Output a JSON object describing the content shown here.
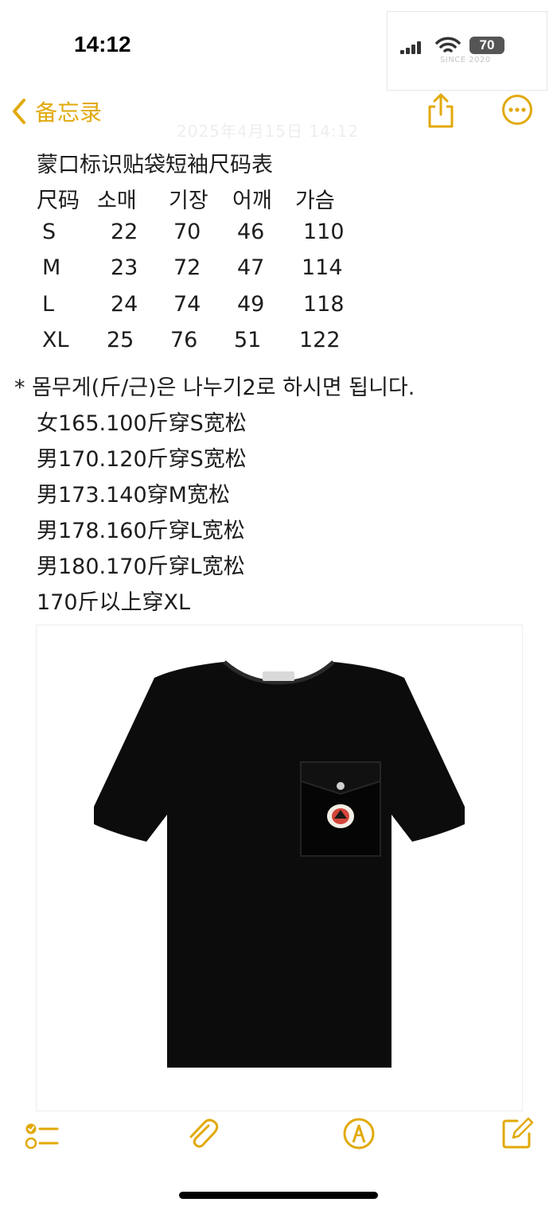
{
  "status_bar": {
    "time": "14:12",
    "battery": "70",
    "watermark": "SINCE 2020"
  },
  "nav": {
    "back_label": "备忘录",
    "back_icon": "chevron-left-icon",
    "share_icon": "share-icon",
    "more_icon": "ellipsis-circle-icon",
    "accent_color": "#e1a909"
  },
  "note": {
    "date": "2025年4月15日 14:12",
    "title": "蒙口标识贴袋短袖尺码表",
    "table": {
      "headers": [
        "尺码",
        "소매",
        "기장",
        "어깨",
        "가슴"
      ],
      "rows": [
        [
          "S",
          "22",
          "70",
          "46",
          "110"
        ],
        [
          "M",
          "23",
          "72",
          "47",
          "114"
        ],
        [
          "L",
          "24",
          "74",
          "49",
          "118"
        ],
        [
          "XL",
          "25",
          "76",
          "51",
          "122"
        ]
      ]
    },
    "weight_note": "* 몸무게(斤/근)은 나누기2로 하시면 됩니다.",
    "recommendations": [
      "女165.100斤穿S宽松",
      "男170.120斤穿S宽松",
      "男173.140穿M宽松",
      "男178.160斤穿L宽松",
      "男180.170斤穿L宽松",
      "170斤以上穿XL"
    ],
    "image": "black-tshirt-with-logo-pocket"
  },
  "toolbar": {
    "checklist_icon": "checklist-icon",
    "attach_icon": "paperclip-icon",
    "markup_icon": "markup-pen-icon",
    "compose_icon": "compose-icon"
  }
}
